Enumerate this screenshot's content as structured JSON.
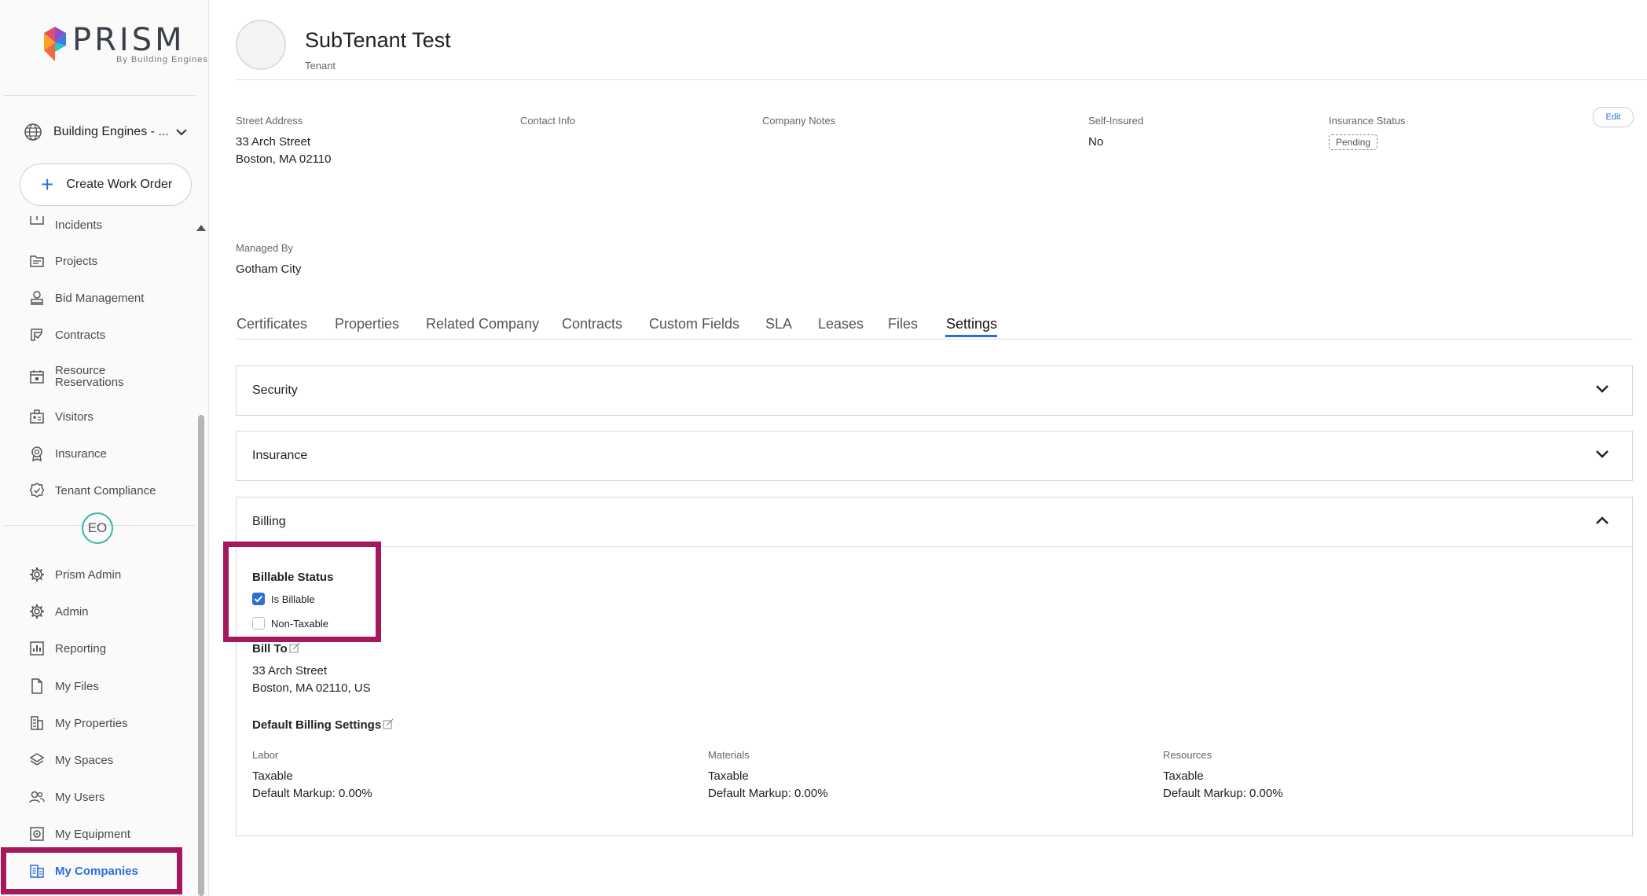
{
  "app": {
    "logo_text": "PRISM",
    "logo_sub": "By Building Engines"
  },
  "sidebar": {
    "building": "Building Engines - ...",
    "create_button": "Create Work Order",
    "items": [
      {
        "label": "Incidents",
        "icon": "incidents-icon"
      },
      {
        "label": "Projects",
        "icon": "projects-icon"
      },
      {
        "label": "Bid Management",
        "icon": "bid-management-icon"
      },
      {
        "label": "Contracts",
        "icon": "contracts-icon"
      },
      {
        "label": "Resource Reservations",
        "icon": "calendar-icon"
      },
      {
        "label": "Visitors",
        "icon": "visitors-icon"
      },
      {
        "label": "Insurance",
        "icon": "insurance-icon"
      },
      {
        "label": "Tenant Compliance",
        "icon": "compliance-icon"
      }
    ],
    "user_initials": "EO",
    "admin_items": [
      {
        "label": "Prism Admin",
        "icon": "gear-icon"
      },
      {
        "label": "Admin",
        "icon": "gear-icon"
      },
      {
        "label": "Reporting",
        "icon": "reporting-icon"
      },
      {
        "label": "My Files",
        "icon": "file-icon"
      },
      {
        "label": "My Properties",
        "icon": "building-icon"
      },
      {
        "label": "My Spaces",
        "icon": "layers-icon"
      },
      {
        "label": "My Users",
        "icon": "users-icon"
      },
      {
        "label": "My Equipment",
        "icon": "equipment-icon"
      },
      {
        "label": "My Companies",
        "icon": "companies-icon",
        "active": true
      }
    ]
  },
  "company": {
    "name": "SubTenant Test",
    "type": "Tenant",
    "edit_label": "Edit",
    "fields": {
      "street_address_label": "Street Address",
      "street_address_line1": "33 Arch Street",
      "street_address_line2": "Boston, MA 02110",
      "contact_info_label": "Contact Info",
      "company_notes_label": "Company Notes",
      "self_insured_label": "Self-Insured",
      "self_insured_value": "No",
      "insurance_status_label": "Insurance Status",
      "insurance_status_value": "Pending",
      "managed_by_label": "Managed By",
      "managed_by_value": "Gotham City"
    }
  },
  "tabs": [
    "Certificates",
    "Properties",
    "Related Company",
    "Contracts",
    "Custom Fields",
    "SLA",
    "Leases",
    "Files",
    "Settings"
  ],
  "active_tab": "Settings",
  "settings": {
    "security_label": "Security",
    "insurance_label": "Insurance",
    "billing": {
      "label": "Billing",
      "billable_status_title": "Billable Status",
      "is_billable_label": "Is Billable",
      "is_billable": true,
      "non_taxable_label": "Non-Taxable",
      "non_taxable": false,
      "bill_to_title": "Bill To",
      "bill_to_line1": "33 Arch Street",
      "bill_to_line2": "Boston, MA 02110, US",
      "default_billing_title": "Default Billing Settings",
      "labor_label": "Labor",
      "labor_tax": "Taxable",
      "labor_markup": "Default Markup: 0.00%",
      "materials_label": "Materials",
      "materials_tax": "Taxable",
      "materials_markup": "Default Markup: 0.00%",
      "resources_label": "Resources",
      "resources_tax": "Taxable",
      "resources_markup": "Default Markup: 0.00%"
    }
  },
  "colors": {
    "accent": "#2b6fd8",
    "highlight": "#a3195b",
    "avatar_ring": "#3bb6a5"
  }
}
